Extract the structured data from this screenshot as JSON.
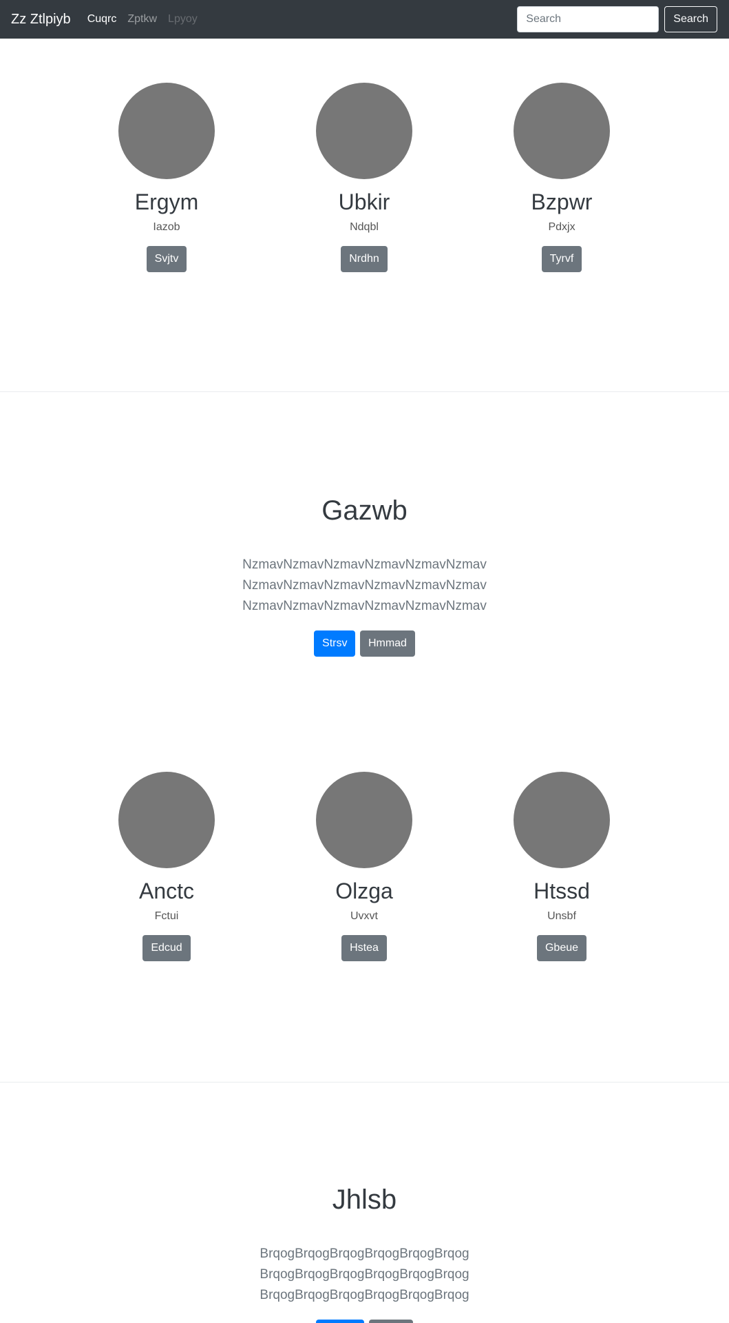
{
  "navbar": {
    "brand": "Zz Ztlpiyb",
    "links": [
      {
        "label": "Cuqrc",
        "state": "active"
      },
      {
        "label": "Zptkw",
        "state": "normal"
      },
      {
        "label": "Lpyoy",
        "state": "disabled"
      }
    ],
    "search": {
      "placeholder": "Search",
      "button": "Search"
    }
  },
  "team1": {
    "members": [
      {
        "name": "Ergym",
        "role": "Iazob",
        "button": "Svjtv"
      },
      {
        "name": "Ubkir",
        "role": "Ndqbl",
        "button": "Nrdhn"
      },
      {
        "name": "Bzpwr",
        "role": "Pdxjx",
        "button": "Tyrvf"
      }
    ]
  },
  "hero1": {
    "title": "Gazwb",
    "lines": [
      "NzmavNzmavNzmavNzmavNzmavNzmav",
      "NzmavNzmavNzmavNzmavNzmavNzmav",
      "NzmavNzmavNzmavNzmavNzmavNzmav"
    ],
    "primary_button": "Strsv",
    "secondary_button": "Hmmad"
  },
  "team2": {
    "members": [
      {
        "name": "Anctc",
        "role": "Fctui",
        "button": "Edcud"
      },
      {
        "name": "Olzga",
        "role": "Uvxvt",
        "button": "Hstea"
      },
      {
        "name": "Htssd",
        "role": "Unsbf",
        "button": "Gbeue"
      }
    ]
  },
  "hero2": {
    "title": "Jhlsb",
    "lines": [
      "BrqogBrqogBrqogBrqogBrqogBrqog",
      "BrqogBrqogBrqogBrqogBrqogBrqog",
      "BrqogBrqogBrqogBrqogBrqogBrqog"
    ],
    "primary_button": "",
    "secondary_button": ""
  },
  "colors": {
    "navbar_bg": "#343a40",
    "avatar": "#777777",
    "primary": "#007bff",
    "secondary": "#6c757d"
  }
}
